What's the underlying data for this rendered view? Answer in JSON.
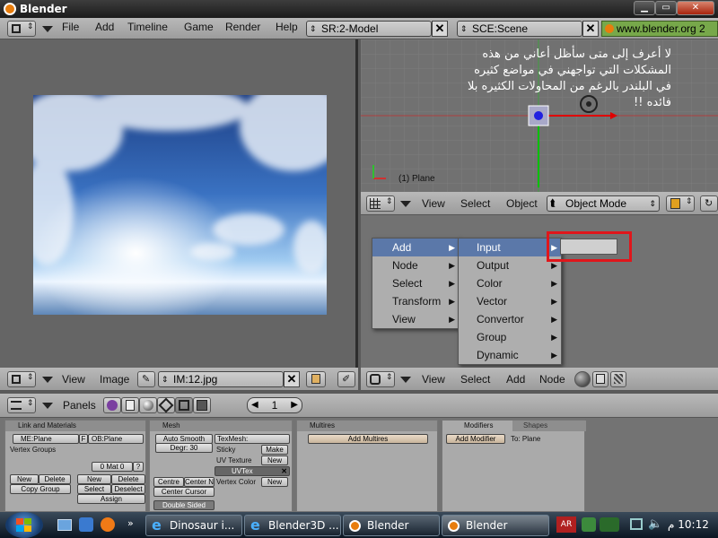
{
  "window": {
    "title": "Blender"
  },
  "top_header": {
    "menus": [
      "File",
      "Add",
      "Timeline",
      "Game",
      "Render",
      "Help"
    ],
    "screen_field": "SR:2-Model",
    "scene_field": "SCE:Scene",
    "site": "www.blender.org 2"
  },
  "viewport3d": {
    "overlay_text": [
      "لا أعرف إلى متى سأظل أعاني من هذه",
      "المشكلات التي تواجهني في مواضع كثيره",
      "في البلندر بالرغم من المحاولات الكثيره بلا",
      "فائده !!"
    ],
    "object_label": "(1) Plane",
    "header": {
      "view": "View",
      "select": "Select",
      "object": "Object",
      "mode": "Object Mode"
    }
  },
  "image_editor": {
    "header": {
      "view": "View",
      "image": "Image",
      "image_field": "IM:12.jpg"
    }
  },
  "node_editor": {
    "header": {
      "view": "View",
      "select": "Select",
      "add": "Add",
      "node": "Node"
    },
    "menu": [
      {
        "label": "Add",
        "selected": true
      },
      {
        "label": "Node"
      },
      {
        "label": "Select"
      },
      {
        "label": "Transform"
      },
      {
        "label": "View"
      }
    ],
    "submenu": [
      {
        "label": "Input",
        "selected": true
      },
      {
        "label": "Output"
      },
      {
        "label": "Color"
      },
      {
        "label": "Vector"
      },
      {
        "label": "Convertor"
      },
      {
        "label": "Group"
      },
      {
        "label": "Dynamic"
      }
    ],
    "highlight_color": "#e0161b"
  },
  "buttons_window": {
    "header": {
      "panels": "Panels",
      "frame": "1"
    },
    "link_panel": {
      "title": "Link and Materials",
      "me_field": "ME:Plane",
      "f_label": "F",
      "ob_field": "OB:Plane",
      "vertex_groups": "Vertex Groups",
      "mat_field": "0 Mat 0",
      "mat_help": "?",
      "new1": "New",
      "delete1": "Delete",
      "copy_group": "Copy Group",
      "new2": "New",
      "delete2": "Delete",
      "select": "Select",
      "deselect": "Deselect",
      "assign": "Assign"
    },
    "mesh_panel": {
      "title": "Mesh",
      "auto_smooth": "Auto Smooth",
      "degr": "Degr: 30",
      "texmesh": "TexMesh:",
      "sticky": "Sticky",
      "make": "Make",
      "uv_texture": "UV Texture",
      "new_uv": "New",
      "uvtex": "UVTex",
      "vertex_color": "Vertex Color",
      "new_vc": "New",
      "centre": "Centre",
      "centre_new": "Center Ne",
      "center_cursor": "Center Cursor",
      "double_sided": "Double Sided"
    },
    "multires_panel": {
      "title": "Multires",
      "add": "Add Multires"
    },
    "modifiers_panel": {
      "tab1": "Modifiers",
      "tab2": "Shapes",
      "add": "Add Modifier",
      "to": "To: Plane"
    }
  },
  "taskbar": {
    "tasks": [
      {
        "label": "Dinosaur i...",
        "icon": "ie-icon"
      },
      {
        "label": "Blender3D ...",
        "icon": "ie-icon"
      },
      {
        "label": "Blender",
        "icon": "blender-icon"
      },
      {
        "label": "Blender",
        "icon": "blender-icon",
        "active": true
      }
    ],
    "lang": "AR",
    "clock": "10:12 م"
  }
}
